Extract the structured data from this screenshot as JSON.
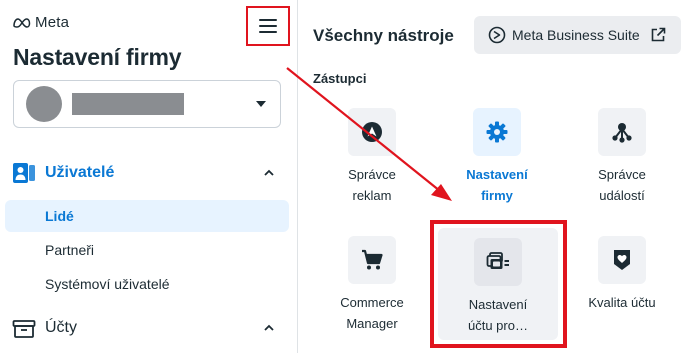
{
  "brand": {
    "logo_text": "Meta"
  },
  "sidebar": {
    "title": "Nastavení firmy",
    "menu_icon": "hamburger-menu-icon",
    "account": {
      "avatar": "avatar-placeholder",
      "name": ""
    },
    "sections": [
      {
        "label": "Uživatelé",
        "icon": "users-icon",
        "expanded": true,
        "items": [
          {
            "label": "Lidé",
            "active": true
          },
          {
            "label": "Partneři",
            "active": false
          },
          {
            "label": "Systémoví uživatelé",
            "active": false
          }
        ]
      },
      {
        "label": "Účty",
        "icon": "briefcase-icon",
        "expanded": true
      }
    ]
  },
  "panel": {
    "title": "Všechny nástroje",
    "business_suite_button": {
      "label": "Meta Business Suite",
      "icon": "meta-business-suite-icon",
      "trailing_icon": "external-link-icon"
    },
    "groups": [
      {
        "label": "Zástupci",
        "tools": [
          {
            "line1": "Správce",
            "line2": "reklam",
            "icon": "ads-manager-icon",
            "selected": false
          },
          {
            "line1": "Nastavení",
            "line2": "firmy",
            "icon": "gear-icon",
            "selected": true
          },
          {
            "line1": "Správce",
            "line2": "událostí",
            "icon": "events-manager-icon",
            "selected": false
          },
          {
            "line1": "Commerce",
            "line2": "Manager",
            "icon": "shopping-cart-icon",
            "selected": false
          },
          {
            "line1": "Nastavení",
            "line2": "účtu pro…",
            "icon": "account-settings-icon",
            "selected": false,
            "highlighted": true
          },
          {
            "line1": "Kvalita účtu",
            "line2": "",
            "icon": "account-quality-icon",
            "selected": false
          }
        ]
      }
    ]
  },
  "colors": {
    "accent_blue": "#0a78d4",
    "selected_bg": "#e7f3ff",
    "annotation_red": "#e0141e",
    "text_primary": "#1c2b33",
    "tile_bg": "#f0f2f5"
  }
}
